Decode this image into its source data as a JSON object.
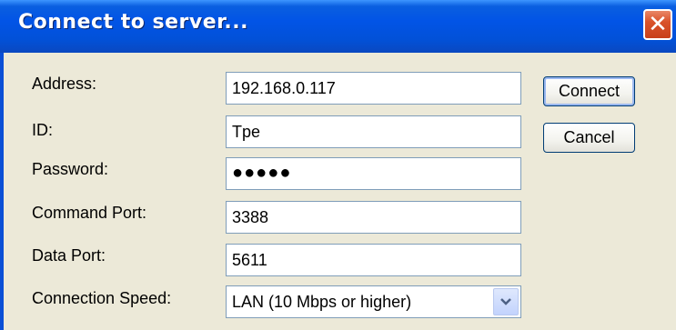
{
  "window": {
    "title": "Connect to server..."
  },
  "titlebar": {
    "close_glyph": "✕"
  },
  "form": {
    "address": {
      "label": "Address:",
      "value": "192.168.0.117"
    },
    "id": {
      "label": "ID:",
      "value": "Tpe"
    },
    "password": {
      "label": "Password:",
      "value": "●●●●●"
    },
    "command_port": {
      "label": "Command Port:",
      "value": "3388"
    },
    "data_port": {
      "label": "Data Port:",
      "value": "5611"
    },
    "connection_speed": {
      "label": "Connection Speed:",
      "value": "LAN (10 Mbps or higher)"
    }
  },
  "buttons": {
    "connect": "Connect",
    "cancel": "Cancel"
  },
  "colors": {
    "titlebar": "#0254e6",
    "close_button": "#d9532b",
    "dialog_background": "#ece9d8",
    "field_border": "#7f9db9",
    "button_border": "#003c74"
  },
  "icons": {
    "close": "close-icon",
    "dropdown": "chevron-down-icon"
  }
}
